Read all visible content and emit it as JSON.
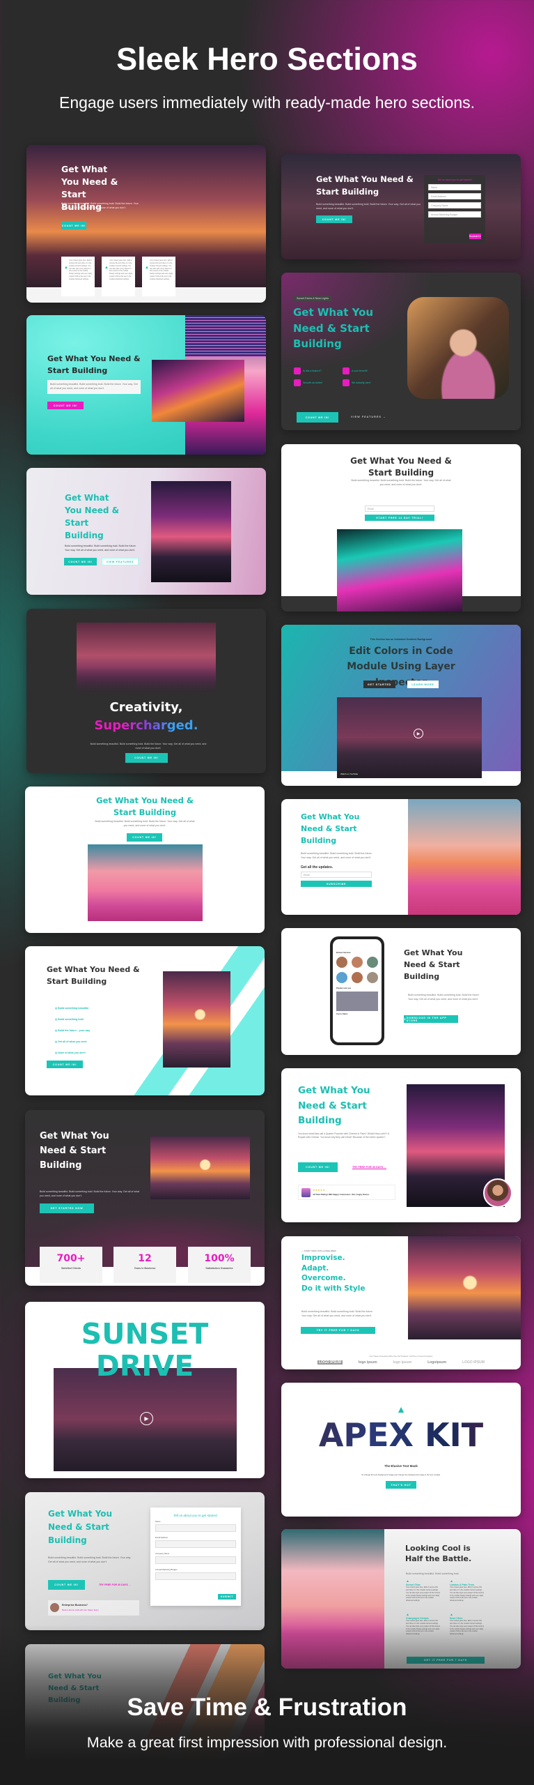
{
  "header": {
    "title": "Sleek Hero Sections",
    "subtitle": "Engage users immediately with ready-made hero sections."
  },
  "footer": {
    "title": "Save Time & Frustration",
    "subtitle": "Make a great first impression with professional design."
  },
  "common": {
    "heading": "Get What You Need & Start Building",
    "body": "Build something beautiful. Build something bold. Build the future. Your way. Get all of what you need, and none of what you don't.",
    "count_me_in": "COUNT ME IN!",
    "view_features": "VIEW FEATURES",
    "module_text": "Your content goes here. Edit or remove this text inline or in the module Content settings. You can also style every aspect of this content in the module Design settings and even apply custom CSS to this text in the module Advanced settings.",
    "accent_teal": "#1cc4b6",
    "accent_pink": "#e81cbf"
  },
  "form": {
    "title": "Tell us about you to get started",
    "title_dot": "Tell us about you to get started.",
    "fields": [
      "Name",
      "Email Address",
      "Company Name",
      "Annual Marketing Budget"
    ],
    "submit": "Submit",
    "submit_caps": "SUBMIT"
  },
  "r2": {
    "badge": "Sunset Drives & Neon Lights",
    "features": [
      "Is this a feature?",
      "A cool benefit!",
      "Smooth as butter!",
      "We actually care!"
    ],
    "view_features": "VIEW FEATURES →"
  },
  "r3": {
    "email_placeholder": "Email",
    "cta": "START FREE 14 DAY TRIAL!"
  },
  "r4": {
    "eyebrow": "This Section has an Animated Gradient Background",
    "title": "Edit Colors in Code Module Using Layer Inspector",
    "get_started": "GET STARTED",
    "learn_more": "LEARN MORE",
    "watch": "Watch on YouTube"
  },
  "l4": {
    "line1": "Creativity,",
    "line2": "Supercharged."
  },
  "r5": {
    "updates": "Get all the updates.",
    "email_placeholder": "Email",
    "subscribe": "SUBSCRIBE"
  },
  "l6": {
    "list": [
      "Build something beautiful",
      "Build something bold",
      "Build the future... your way",
      "Get all of what you need",
      "None of what you don't"
    ]
  },
  "r6": {
    "cta": "DOWNLOAD IN THE APP STORE",
    "phone_sections": [
      "Browse Services",
      "Popular near you"
    ],
    "salon": "Coco's Salon"
  },
  "l7": {
    "cta": "GET STARTED NOW",
    "stats": [
      {
        "value": "700+",
        "label": "Satisfied Clients"
      },
      {
        "value": "12",
        "label": "Years in Business"
      },
      {
        "value": "100%",
        "label": "Satisfaction Guarantee"
      }
    ]
  },
  "r7": {
    "body": "You know what they call a Quarter Pounder with Cheese in Paris? What'd they call it? A Royale with Cheese. You know why they call it that? Because of the metric system?",
    "try_free": "TRY FREE FOR 30 DAYS →",
    "stars": "★★★★★",
    "rating": "4.8 Star Rating! 999 Happy Customers. One Angry Karen."
  },
  "l8": {
    "line1": "SUNSET",
    "line2": "DRIVE"
  },
  "r8": {
    "eyebrow": "— START TODAY WITH A FREE WEEK",
    "lines": [
      "Improvise.",
      "Adapt.",
      "Overcome.",
      "Do it with Style"
    ],
    "cta": "TRY IT FREE FOR 7 DAYS",
    "caption": "Join These Innovators Who Use Our Product. You'll be in Good Company.",
    "logos": [
      "LOGO IPSUM",
      "logo ipsum",
      "logo ipsum",
      "Logoipsum",
      "LOGO IPSUM"
    ]
  },
  "l9": {
    "try_free": "TRY FREE FOR 30 DAYS →",
    "enterprise": "Enterprise Business?",
    "demo": "Book a Demo Call with Our Sales Team"
  },
  "r9": {
    "title": "APEX KIT",
    "subtitle": "The Elusive Text Mask",
    "desc": "To change the text background image just change the background image in the text module.",
    "cta": "THAT'S HOT"
  },
  "r10": {
    "title": "Looking Cool is Half the Battle.",
    "body": "Build something beautiful. Build something bold.",
    "features": [
      "Sunset Glow",
      "Lambos & Palm Trees",
      "Champagne Dreams",
      "Neon Vibes"
    ],
    "cta": "GET IT FREE FOR 7 DAYS"
  }
}
